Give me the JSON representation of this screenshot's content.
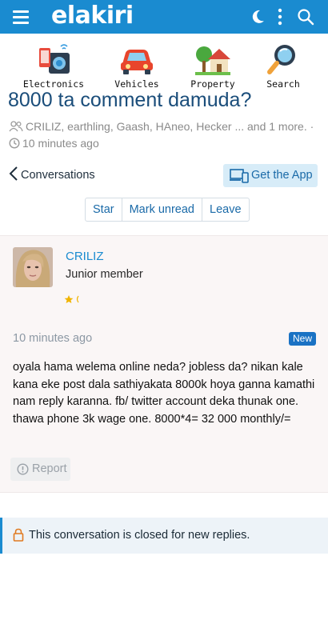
{
  "header": {
    "logo": "elakiri",
    "icons": [
      "menu-icon",
      "moon-icon",
      "more-vertical-icon",
      "search-icon"
    ],
    "accent_color": "#1a8bd0"
  },
  "categories": [
    {
      "label": "Electronics",
      "icon": "electronics-icon"
    },
    {
      "label": "Vehicles",
      "icon": "car-icon"
    },
    {
      "label": "Property",
      "icon": "house-icon"
    },
    {
      "label": "Search",
      "icon": "magnifier-icon"
    }
  ],
  "thread": {
    "title": "8000 ta comment damuda?",
    "participants": "CRILIZ, earthling, Gaash, HAneo, Hecker ... and 1 more. ·",
    "time": "10 minutes ago"
  },
  "nav": {
    "back_label": "Conversations",
    "get_app_label": "Get the App"
  },
  "actions": {
    "star": "Star",
    "mark_unread": "Mark unread",
    "leave": "Leave"
  },
  "post": {
    "username": "CRILIZ",
    "user_title": "Junior member",
    "time": "10 minutes ago",
    "badge": "New",
    "body": "oyala hama welema online neda? jobless da? nikan kale kana eke post dala sathiyakata 8000k hoya ganna kamathi nam reply karanna. fb/ twitter account deka thunak one. thawa phone 3k wage one. 8000*4= 32 000 monthly/=",
    "report_label": "Report"
  },
  "notice": {
    "text": "This conversation is closed for new replies."
  }
}
